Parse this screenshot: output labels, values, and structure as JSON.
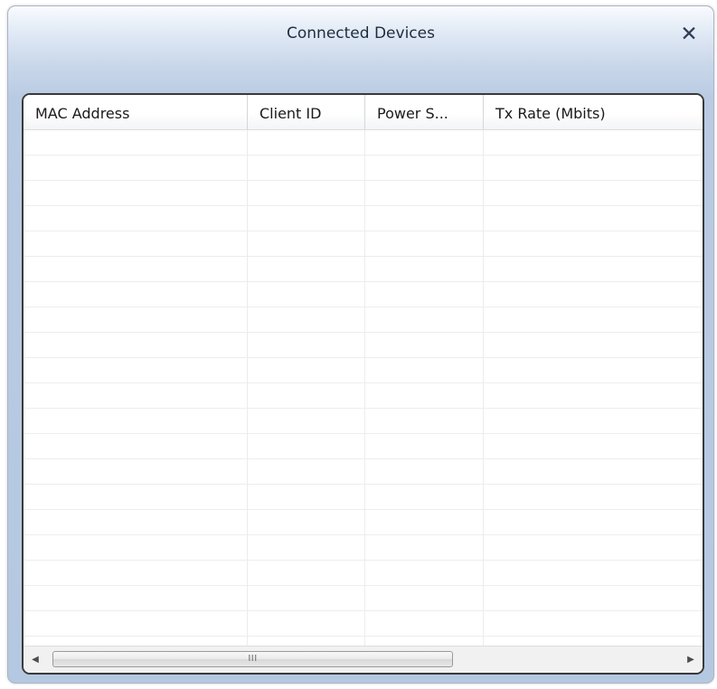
{
  "window": {
    "title": "Connected Devices",
    "close_glyph": "✕"
  },
  "table": {
    "columns": [
      {
        "label": "MAC Address"
      },
      {
        "label": "Client ID"
      },
      {
        "label": "Power S..."
      },
      {
        "label": "Tx Rate (Mbits)"
      }
    ],
    "rows": []
  },
  "scrollbar": {
    "left_arrow": "◀",
    "right_arrow": "▶",
    "grip": "III"
  }
}
